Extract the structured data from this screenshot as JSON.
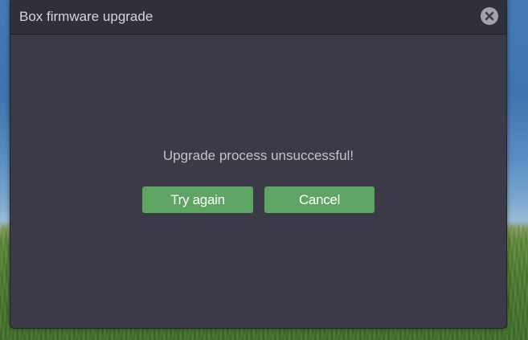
{
  "dialog": {
    "title": "Box firmware upgrade",
    "close_icon": "close-icon",
    "message": "Upgrade process unsuccessful!",
    "buttons": {
      "try_again": "Try again",
      "cancel": "Cancel"
    }
  },
  "colors": {
    "dialog_bg": "#3b3b47",
    "titlebar_bg": "#30303b",
    "button_bg": "#5ea463",
    "title_text": "#d4d4da",
    "message_text": "#c3c3c8"
  }
}
